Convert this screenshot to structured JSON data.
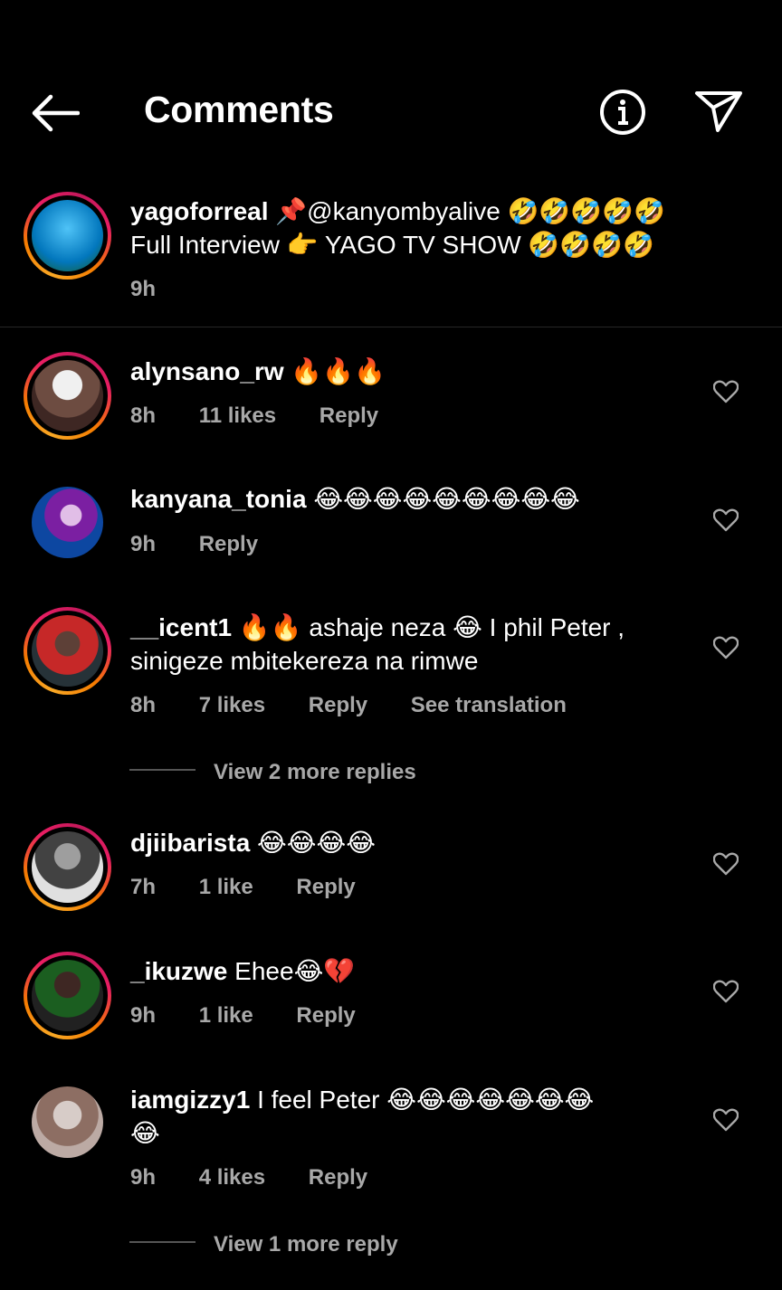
{
  "header": {
    "title": "Comments",
    "back_icon": "back-arrow-icon",
    "info_icon": "info-icon",
    "send_icon": "send-icon"
  },
  "caption": {
    "username": "yagoforreal",
    "line1_text": "📌@kanyombyalive 🤣🤣🤣🤣🤣",
    "line2_text": "Full Interview 👉 YAGO TV SHOW 🤣🤣🤣🤣",
    "time": "9h"
  },
  "comments": [
    {
      "username": "alynsano_rw",
      "text": "🔥🔥🔥",
      "text2": "",
      "time": "8h",
      "likes": "11 likes",
      "reply": "Reply",
      "translate": ""
    },
    {
      "username": "kanyana_tonia",
      "text": "😂😂😂😂😂😂😂😂😂",
      "text2": "",
      "time": "9h",
      "likes": "",
      "reply": "Reply",
      "translate": ""
    },
    {
      "username": "__icent1",
      "text": "🔥🔥 ashaje neza 😂 I phil Peter ,",
      "text2": "sinigeze mbitekereza na rimwe",
      "time": "8h",
      "likes": "7 likes",
      "reply": "Reply",
      "translate": "See translation"
    },
    {
      "username": "djiibarista",
      "text": "😂😂😂😂",
      "text2": "",
      "time": "7h",
      "likes": "1 like",
      "reply": "Reply",
      "translate": ""
    },
    {
      "username": "_ikuzwe",
      "text": "Ehee😂💔",
      "text2": "",
      "time": "9h",
      "likes": "1 like",
      "reply": "Reply",
      "translate": ""
    },
    {
      "username": "iamgizzy1",
      "text": "I feel Peter 😂😂😂😂😂😂😂",
      "text2": "😂",
      "time": "9h",
      "likes": "4 likes",
      "reply": "Reply",
      "translate": ""
    }
  ],
  "view_replies": [
    "View 2 more replies",
    "View 1 more reply"
  ],
  "colors": {
    "background": "#000000",
    "secondary_text": "#a8a8a8",
    "ring_start": "#f9a825",
    "ring_end": "#e91e63"
  }
}
